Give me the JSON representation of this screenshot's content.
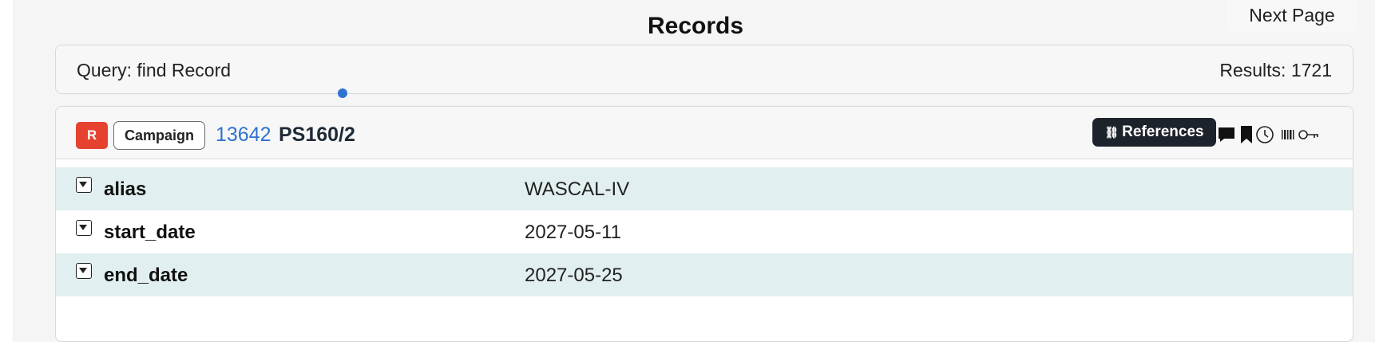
{
  "header": {
    "title": "Records",
    "next_page_label": "Next Page"
  },
  "query": {
    "text": "Query: find Record",
    "results": "Results: 1721"
  },
  "record": {
    "badge_letter": "R",
    "type_label": "Campaign",
    "id": "13642",
    "name": "PS160/2",
    "references_label": "References",
    "badge_color": "#e5432f",
    "accent_color": "#2f73d0",
    "header_icons": [
      "comment-icon",
      "bookmark-icon",
      "history-icon",
      "barcode-icon",
      "key-icon"
    ],
    "properties": [
      {
        "key": "alias",
        "value": "WASCAL-IV"
      },
      {
        "key": "start_date",
        "value": "2027-05-11"
      },
      {
        "key": "end_date",
        "value": "2027-05-25"
      }
    ]
  }
}
